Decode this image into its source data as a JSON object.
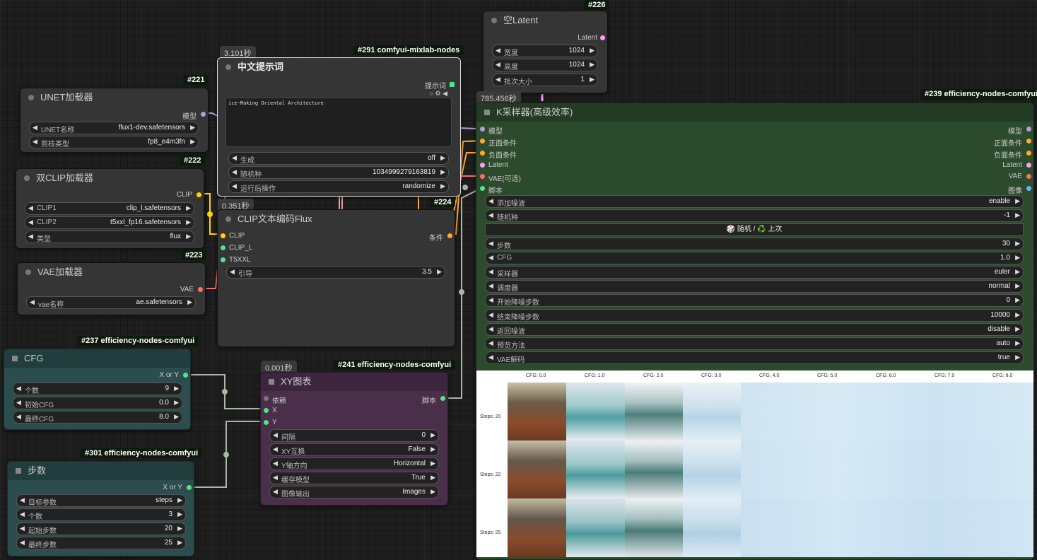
{
  "colors": {
    "model": "#b39ddb",
    "clip": "#ffd500",
    "vae": "#ff6e6e",
    "cond": "#ffa931",
    "latent": "#ff9cf9",
    "xy": "#57e389",
    "image": "#64b5f6"
  },
  "n226": {
    "badge": "#226",
    "title": "空Latent",
    "out": "Latent",
    "w": [
      {
        "l": "宽度",
        "v": "1024"
      },
      {
        "l": "高度",
        "v": "1024"
      },
      {
        "l": "批次大小",
        "v": "1"
      }
    ]
  },
  "n291": {
    "badge": "#291 comfyui-mixlab-nodes",
    "timer": "3.101秒",
    "title": "中文提示词",
    "out": "提示词",
    "prompt": "ice-Making Oriental Architecture",
    "w": [
      {
        "l": "生成",
        "v": "off"
      },
      {
        "l": "随机种",
        "v": "1034999279163819"
      },
      {
        "l": "运行后操作",
        "v": "randomize"
      }
    ]
  },
  "n221": {
    "badge": "#221",
    "title": "UNET加载器",
    "out": "模型",
    "w": [
      {
        "l": "UNET名称",
        "v": "flux1-dev.safetensors"
      },
      {
        "l": "剪枝类型",
        "v": "fp8_e4m3fn"
      }
    ]
  },
  "n222": {
    "badge": "#222",
    "title": "双CLIP加载器",
    "out": "CLIP",
    "w": [
      {
        "l": "CLIP1",
        "v": "clip_l.safetensors"
      },
      {
        "l": "CLIP2",
        "v": "t5xxl_fp16.safetensors"
      },
      {
        "l": "类型",
        "v": "flux"
      }
    ]
  },
  "n223": {
    "badge": "#223",
    "title": "VAE加载器",
    "out": "VAE",
    "w": [
      {
        "l": "vae名称",
        "v": "ae.safetensors"
      }
    ]
  },
  "n224": {
    "badge": "#224",
    "timer": "0.351秒",
    "title": "CLIP文本编码Flux",
    "inputs": [
      "CLIP",
      "CLIP_L",
      "T5XXL"
    ],
    "out": "条件",
    "w": [
      {
        "l": "引导",
        "v": "3.5"
      }
    ]
  },
  "n239": {
    "badge": "#239 efficiency-nodes-comfyui",
    "timer": "785.456秒",
    "title": "K采样器(高级效率)",
    "inputs": [
      "模型",
      "正面条件",
      "负面条件",
      "Latent",
      "VAE(可选)",
      "脚本"
    ],
    "outputs": [
      "模型",
      "正面条件",
      "负面条件",
      "Latent",
      "VAE",
      "图像"
    ],
    "w": [
      {
        "l": "添加噪波",
        "v": "enable"
      },
      {
        "l": "随机种",
        "v": "-1"
      }
    ],
    "seed_btn": "🎲 随机 / ♻️ 上次",
    "w2": [
      {
        "l": "步数",
        "v": "30"
      },
      {
        "l": "CFG",
        "v": "1.0"
      },
      {
        "l": "采样器",
        "v": "euler"
      },
      {
        "l": "调度器",
        "v": "normal"
      },
      {
        "l": "开始降噪步数",
        "v": "0"
      },
      {
        "l": "结束降噪步数",
        "v": "10000"
      },
      {
        "l": "返回噪波",
        "v": "disable"
      },
      {
        "l": "预览方法",
        "v": "auto"
      },
      {
        "l": "VAE解码",
        "v": "true"
      }
    ],
    "grid": {
      "cols": [
        "CFG: 0.0",
        "CFG: 1.0",
        "CFG: 2.0",
        "CFG: 3.0",
        "CFG: 4.0",
        "CFG: 5.0",
        "CFG: 6.0",
        "CFG: 7.0",
        "CFG: 8.0"
      ],
      "rows": [
        "Steps: 20",
        "Steps: 22",
        "Steps: 25"
      ]
    }
  },
  "n237": {
    "badge": "#237 efficiency-nodes-comfyui",
    "title": "CFG",
    "out": "X or Y",
    "w": [
      {
        "l": "个数",
        "v": "9"
      },
      {
        "l": "初始CFG",
        "v": "0.0"
      },
      {
        "l": "最终CFG",
        "v": "8.0"
      }
    ]
  },
  "n241": {
    "badge": "#241 efficiency-nodes-comfyui",
    "timer": "0.001秒",
    "title": "XY图表",
    "inputs": [
      "依赖",
      "X",
      "Y"
    ],
    "out": "脚本",
    "w": [
      {
        "l": "间隔",
        "v": "0"
      },
      {
        "l": "XY互换",
        "v": "False"
      },
      {
        "l": "Y轴方向",
        "v": "Horizontal"
      },
      {
        "l": "缓存模型",
        "v": "True"
      },
      {
        "l": "图像输出",
        "v": "Images"
      }
    ]
  },
  "n301": {
    "badge": "#301 efficiency-nodes-comfyui",
    "title": "步数",
    "out": "X or Y",
    "w": [
      {
        "l": "目标参数",
        "v": "steps"
      },
      {
        "l": "个数",
        "v": "3"
      },
      {
        "l": "起始步数",
        "v": "20"
      },
      {
        "l": "最终步数",
        "v": "25"
      }
    ]
  }
}
